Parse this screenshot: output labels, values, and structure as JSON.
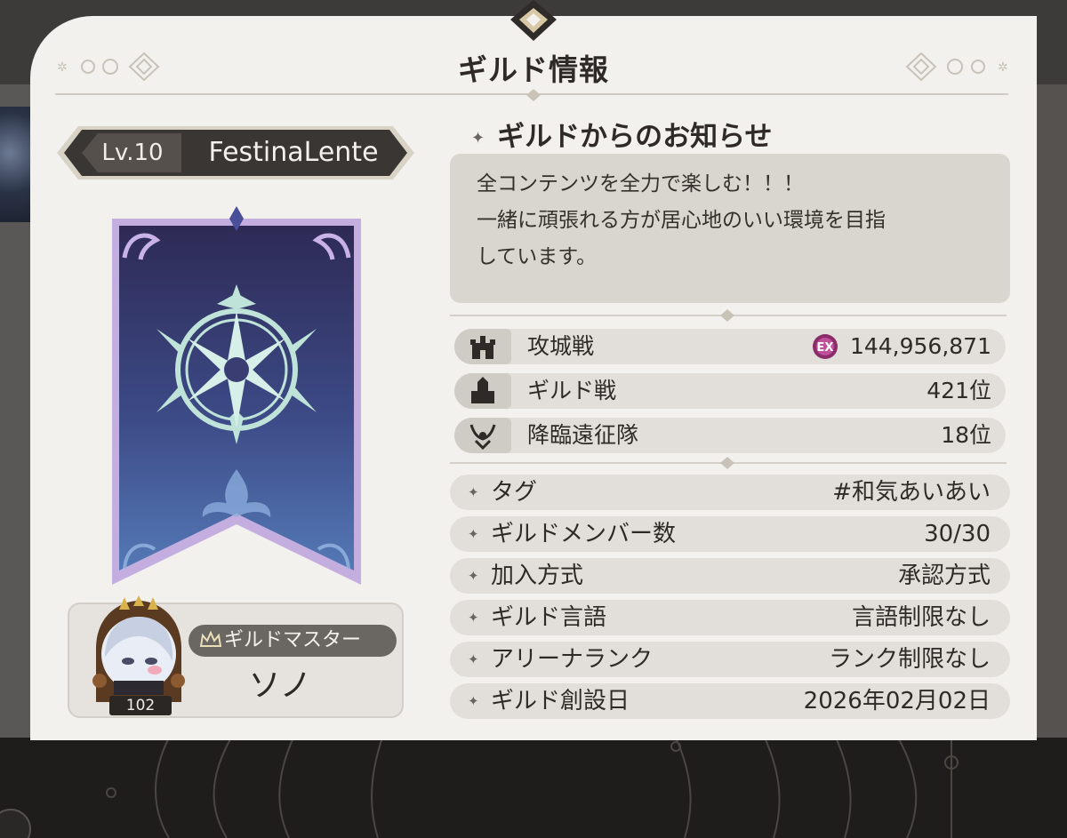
{
  "dialog": {
    "title": "ギルド情報"
  },
  "guild": {
    "level": "Lv.10",
    "name": "FestinaLente"
  },
  "master": {
    "role_label": "ギルドマスター",
    "name": "ソノ",
    "level": "102"
  },
  "notice": {
    "heading": "ギルドからのお知らせ",
    "body": "全コンテンツを全力で楽しむ！！！\n一緒に頑張れる方が居心地のいい環境を目指\nしています。"
  },
  "stats": [
    {
      "label": "攻城戦",
      "value": "144,956,871",
      "icon": "castle-icon",
      "badge": "EX"
    },
    {
      "label": "ギルド戦",
      "value": "421位",
      "icon": "fortress-icon"
    },
    {
      "label": "降臨遠征隊",
      "value": "18位",
      "icon": "horned-crest-icon"
    }
  ],
  "info": [
    {
      "label": "タグ",
      "value": "#和気あいあい"
    },
    {
      "label": "ギルドメンバー数",
      "value": "30/30"
    },
    {
      "label": "加入方式",
      "value": "承認方式"
    },
    {
      "label": "ギルド言語",
      "value": "言語制限なし"
    },
    {
      "label": "アリーナランク",
      "value": "ランク制限なし"
    },
    {
      "label": "ギルド創設日",
      "value": "2026年02月02日"
    }
  ],
  "colors": {
    "panel_bg": "#f3f1ee",
    "row_bg": "#e2dfda",
    "banner_top": "#2e2a55",
    "banner_bottom": "#4f72b0",
    "emblem": "#bfe3d8",
    "ex_badge": "#8a2d6a"
  }
}
